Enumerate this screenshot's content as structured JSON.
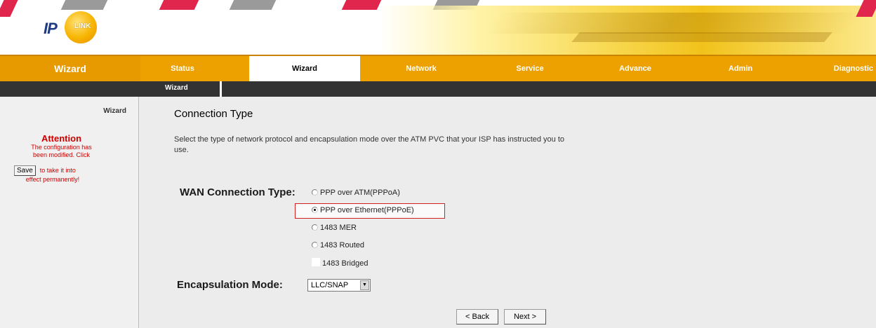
{
  "brand": "Wizard",
  "logo": {
    "text_ip": "IP",
    "text_link": "LINK"
  },
  "tabs": [
    {
      "label": "Status",
      "active": false
    },
    {
      "label": "Wizard",
      "active": true
    },
    {
      "label": "Network",
      "active": false
    },
    {
      "label": "Service",
      "active": false
    },
    {
      "label": "Advance",
      "active": false
    },
    {
      "label": "Admin",
      "active": false
    },
    {
      "label": "Diagnostic",
      "active": false
    }
  ],
  "subtab": "Wizard",
  "sidebar": {
    "title": "Wizard",
    "attention_title": "Attention",
    "attention_line1": "The configuration has",
    "attention_line2": "been modified. Click",
    "save_label": "Save",
    "after_save": "to take it into",
    "last_line": "effect permanently!"
  },
  "main": {
    "heading": "Connection Type",
    "description": "Select the type of network protocol and encapsulation mode over the ATM PVC that your ISP has instructed you to use.",
    "wan_label": "WAN Connection Type:",
    "options": [
      {
        "label": "PPP over ATM(PPPoA)",
        "selected": false
      },
      {
        "label": "PPP over Ethernet(PPPoE)",
        "selected": true
      },
      {
        "label": "1483 MER",
        "selected": false
      },
      {
        "label": "1483 Routed",
        "selected": false
      },
      {
        "label": "1483 Bridged",
        "selected": false
      }
    ],
    "encapsulation_label": "Encapsulation Mode:",
    "encapsulation_value": "LLC/SNAP",
    "back_label": "< Back",
    "next_label": "Next >"
  },
  "colors": {
    "tabbar": "#eda100",
    "accent_red": "#e0264c",
    "attention_red": "#cc0000"
  }
}
